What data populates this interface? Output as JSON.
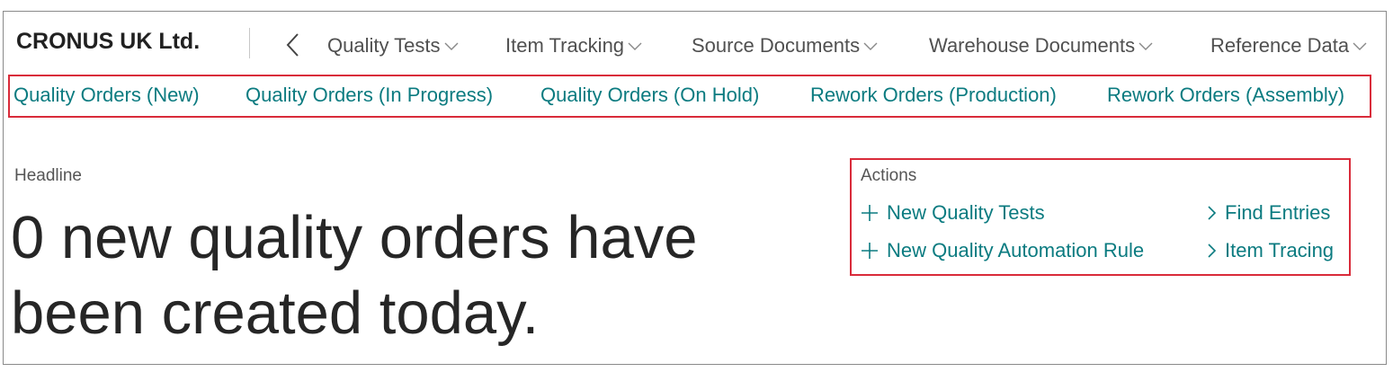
{
  "header": {
    "company": "CRONUS UK Ltd.",
    "menu": [
      {
        "label": "Quality Tests"
      },
      {
        "label": "Item Tracking"
      },
      {
        "label": "Source Documents"
      },
      {
        "label": "Warehouse Documents"
      },
      {
        "label": "Reference Data"
      }
    ]
  },
  "nav_links": [
    "Quality Orders (New)",
    "Quality Orders (In Progress)",
    "Quality Orders (On Hold)",
    "Rework Orders (Production)",
    "Rework Orders (Assembly)"
  ],
  "headline": {
    "label": "Headline",
    "text": "0 new quality orders have been created today."
  },
  "actions": {
    "label": "Actions",
    "new_quality_tests": "New Quality Tests",
    "new_quality_automation_rule": "New Quality Automation Rule",
    "find_entries": "Find Entries",
    "item_tracing": "Item Tracing"
  },
  "colors": {
    "link": "#0b7b80",
    "highlight_box": "#d92b3a",
    "text": "#212121"
  },
  "icons": {
    "back": "chevron-left-icon",
    "dropdown": "chevron-down-icon",
    "new": "plus-icon",
    "go": "chevron-right-icon"
  }
}
